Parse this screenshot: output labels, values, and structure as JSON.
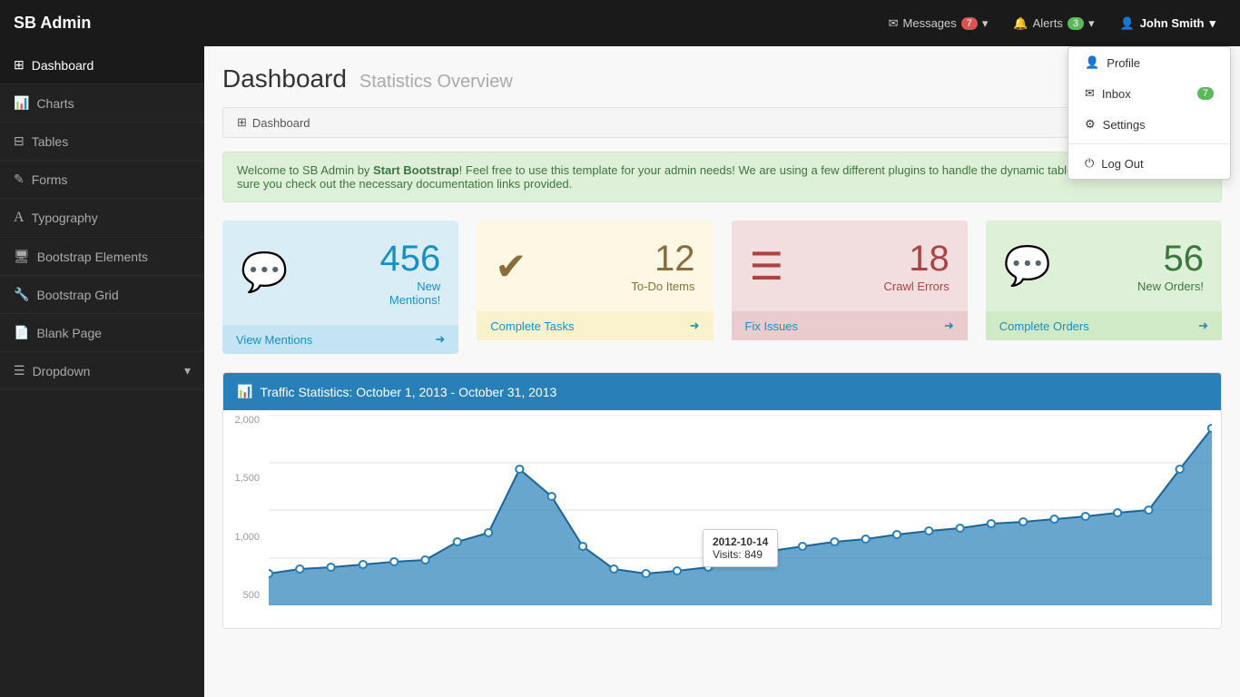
{
  "app": {
    "brand": "SB Admin"
  },
  "topnav": {
    "messages_label": "Messages",
    "messages_count": "7",
    "alerts_label": "Alerts",
    "alerts_count": "3",
    "user_name": "John Smith"
  },
  "dropdown_menu": {
    "items": [
      {
        "id": "profile",
        "icon": "👤",
        "label": "Profile"
      },
      {
        "id": "inbox",
        "icon": "✉",
        "label": "Inbox",
        "badge": "7"
      },
      {
        "id": "settings",
        "icon": "⚙",
        "label": "Settings"
      },
      {
        "id": "logout",
        "icon": "⏻",
        "label": "Log Out",
        "divider_before": true
      }
    ]
  },
  "sidebar": {
    "items": [
      {
        "id": "dashboard",
        "icon": "⊞",
        "label": "Dashboard",
        "active": true
      },
      {
        "id": "charts",
        "icon": "📊",
        "label": "Charts"
      },
      {
        "id": "tables",
        "icon": "⊟",
        "label": "Tables"
      },
      {
        "id": "forms",
        "icon": "✎",
        "label": "Forms"
      },
      {
        "id": "typography",
        "icon": "A",
        "label": "Typography"
      },
      {
        "id": "bootstrap-elements",
        "icon": "🖥",
        "label": "Bootstrap Elements"
      },
      {
        "id": "bootstrap-grid",
        "icon": "🔧",
        "label": "Bootstrap Grid"
      },
      {
        "id": "blank-page",
        "icon": "📄",
        "label": "Blank Page"
      },
      {
        "id": "dropdown",
        "icon": "☰",
        "label": "Dropdown",
        "has_arrow": true
      }
    ]
  },
  "page": {
    "title": "Dashboard",
    "subtitle": "Statistics Overview",
    "breadcrumb_icon": "⊞",
    "breadcrumb_text": "Dashboard"
  },
  "alert": {
    "text_1": "Welcome to SB Admin by ",
    "brand": "Start Bootstrap",
    "text_2": "! Feel free to use this template for your admin needs! We are using a few different plugins to handle the dynamic tables and charts, so make sure you check out the necessary documentation links provided."
  },
  "stat_boxes": [
    {
      "id": "mentions",
      "type": "blue",
      "icon": "💬",
      "number": "456",
      "label_line1": "New",
      "label_line2": "Mentions!",
      "action_label": "View Mentions",
      "action_icon": "➜"
    },
    {
      "id": "todo",
      "type": "yellow",
      "icon": "✔",
      "number": "12",
      "label": "To-Do Items",
      "action_label": "Complete Tasks",
      "action_icon": "➜"
    },
    {
      "id": "errors",
      "type": "red",
      "icon": "☰",
      "number": "18",
      "label": "Crawl Errors",
      "action_label": "Fix Issues",
      "action_icon": "➜"
    },
    {
      "id": "orders",
      "type": "green",
      "icon": "💬",
      "number": "56",
      "label": "New Orders!",
      "action_label": "Complete Orders",
      "action_icon": "➜"
    }
  ],
  "chart": {
    "title": "Traffic Statistics: October 1, 2013 - October 31, 2013",
    "icon": "📊",
    "y_labels": [
      "2,000",
      "1,500",
      "1,000",
      "500"
    ],
    "tooltip_date": "2012-10-14",
    "tooltip_label": "Visits:",
    "tooltip_value": "849"
  }
}
